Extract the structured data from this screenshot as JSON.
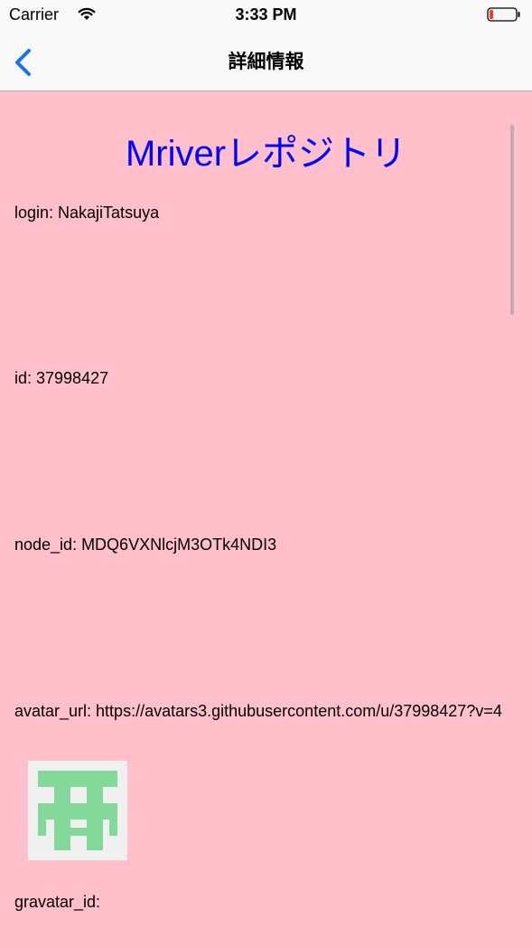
{
  "status_bar": {
    "carrier": "Carrier",
    "time": "3:33 PM",
    "battery_color": "#ff3b30"
  },
  "nav": {
    "title": "詳細情報",
    "back_icon": "chevron-left-icon",
    "tint_color": "#1a73e8"
  },
  "content": {
    "background": "#ffc0cb",
    "title": "Mriverレポジトリ",
    "title_color": "#0000ff",
    "fields": {
      "login": "login: NakajiTatsuya",
      "id": "id: 37998427",
      "node_id": "node_id: MDQ6VXNlcjM3OTk4NDI3",
      "avatar_url": "avatar_url: https://avatars3.githubusercontent.com/u/37998427?v=4",
      "gravatar_id": "gravatar_id:"
    },
    "avatar": {
      "icon": "identicon-avatar",
      "color": "#84d99a"
    }
  }
}
